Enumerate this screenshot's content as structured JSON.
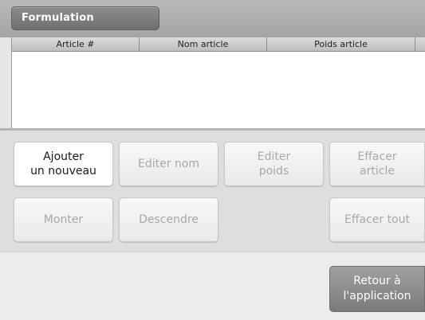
{
  "header": {
    "title": "Formulation"
  },
  "table": {
    "columns": [
      "Article #",
      "Nom article",
      "Poids article"
    ],
    "rows": []
  },
  "buttons": {
    "add_new": "Ajouter\nun nouveau",
    "edit_name": "Editer nom",
    "edit_weight": "Editer\npoids",
    "delete_item": "Effacer\narticle",
    "move_up": "Monter",
    "move_down": "Descendre",
    "delete_all": "Effacer tout",
    "return_app": "Retour à\nl'application"
  }
}
